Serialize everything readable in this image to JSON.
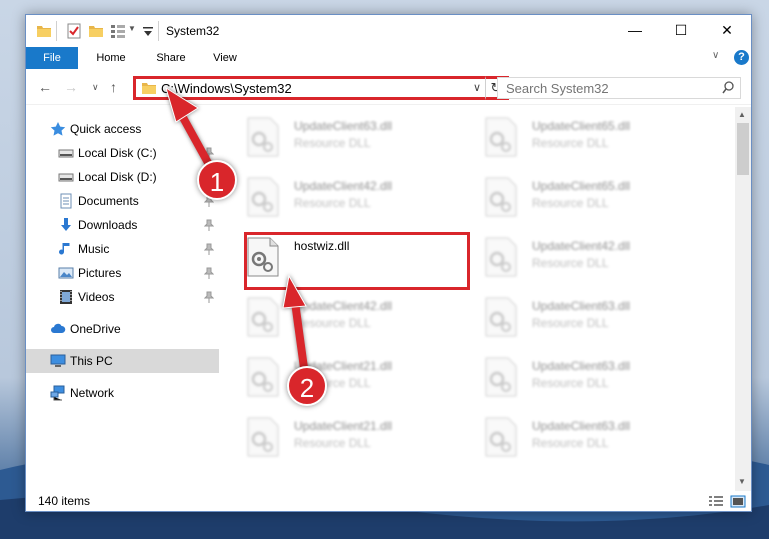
{
  "window": {
    "title": "System32",
    "controls": {
      "minimize": "—",
      "maximize": "☐",
      "close": "✕"
    }
  },
  "ribbon": {
    "tabs": [
      {
        "label": "File"
      },
      {
        "label": "Home"
      },
      {
        "label": "Share"
      },
      {
        "label": "View"
      }
    ],
    "help": "?"
  },
  "navbar": {
    "address": "C:\\Windows\\System32",
    "search_placeholder": "Search System32"
  },
  "sidebar": {
    "items": [
      {
        "label": "Quick access",
        "icon": "star-icon"
      },
      {
        "label": "Local Disk (C:)",
        "icon": "drive-icon",
        "pinned": true
      },
      {
        "label": "Local Disk (D:)",
        "icon": "drive-icon",
        "pinned": true
      },
      {
        "label": "Documents",
        "icon": "documents-icon",
        "pinned": true
      },
      {
        "label": "Downloads",
        "icon": "downloads-icon",
        "pinned": true
      },
      {
        "label": "Music",
        "icon": "music-icon",
        "pinned": true
      },
      {
        "label": "Pictures",
        "icon": "pictures-icon",
        "pinned": true
      },
      {
        "label": "Videos",
        "icon": "videos-icon",
        "pinned": true
      },
      {
        "label": "OneDrive",
        "icon": "onedrive-icon"
      },
      {
        "label": "This PC",
        "icon": "this-pc-icon",
        "selected": true
      },
      {
        "label": "Network",
        "icon": "network-icon"
      }
    ]
  },
  "files": [
    {
      "name": "UpdateClient63.dll",
      "type": "Resource DLL"
    },
    {
      "name": "UpdateClient65.dll",
      "type": "Resource DLL"
    },
    {
      "name": "UpdateClient42.dll",
      "type": "Resource DLL"
    },
    {
      "name": "UpdateClient65.dll",
      "type": "Resource DLL"
    },
    {
      "name": "hostwiz.dll",
      "type": ""
    },
    {
      "name": "UpdateClient42.dll",
      "type": "Resource DLL"
    },
    {
      "name": "UpdateClient42.dll",
      "type": "Resource DLL"
    },
    {
      "name": "UpdateClient63.dll",
      "type": "Resource DLL"
    },
    {
      "name": "UpdateClient21.dll",
      "type": "Resource DLL"
    },
    {
      "name": "UpdateClient63.dll",
      "type": "Resource DLL"
    },
    {
      "name": "UpdateClient21.dll",
      "type": "Resource DLL"
    },
    {
      "name": "UpdateClient63.dll",
      "type": "Resource DLL"
    }
  ],
  "status": {
    "item_count": "140 items"
  },
  "annotations": {
    "step1": "1",
    "step2": "2"
  },
  "colors": {
    "accent": "#1979ca",
    "annotation_red": "#d9262b",
    "selected_bg": "#d9d9d9"
  }
}
